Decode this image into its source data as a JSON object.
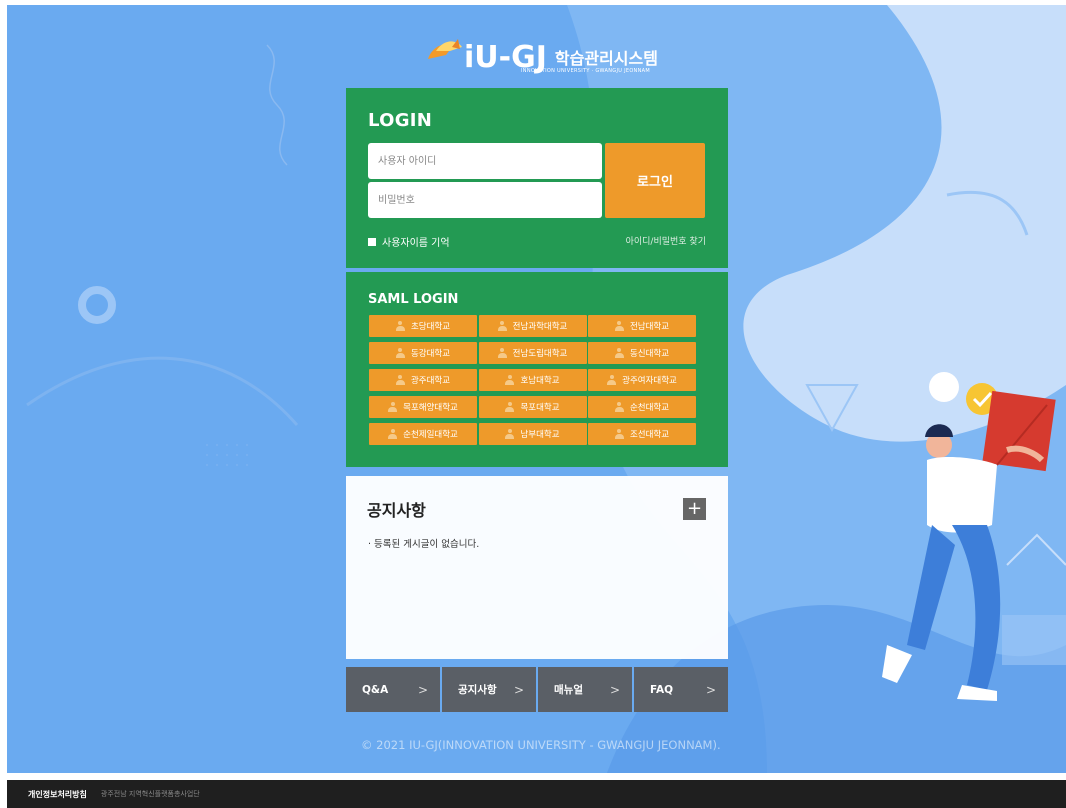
{
  "logo": {
    "brand": "iU-GJ",
    "subtitle": "학습관리시스템",
    "tagline": "INNOVATION UNIVERSITY · GWANGJU JEONNAM"
  },
  "login": {
    "title": "LOGIN",
    "username_placeholder": "사용자 아이디",
    "password_placeholder": "비밀번호",
    "login_button": "로그인",
    "remember_label": "사용자이름 기억",
    "find_link": "아이디/비밀번호 찾기"
  },
  "saml": {
    "title": "SAML LOGIN",
    "universities": [
      "초당대학교",
      "전남과학대학교",
      "전남대학교",
      "동강대학교",
      "전남도립대학교",
      "동신대학교",
      "광주대학교",
      "호남대학교",
      "광주여자대학교",
      "목포해양대학교",
      "목포대학교",
      "순천대학교",
      "순천제일대학교",
      "남부대학교",
      "조선대학교"
    ]
  },
  "notice": {
    "title": "공지사항",
    "plus": "+",
    "empty_message": "· 등록된 게시글이 없습니다."
  },
  "nav": {
    "tabs": [
      {
        "label": "Q&A",
        "chevron": ">"
      },
      {
        "label": "공지사항",
        "chevron": ">"
      },
      {
        "label": "매뉴얼",
        "chevron": ">"
      },
      {
        "label": "FAQ",
        "chevron": ">"
      }
    ]
  },
  "copyright": "© 2021 IU-GJ(INNOVATION UNIVERSITY - GWANGJU JEONNAM).",
  "footer": {
    "privacy": "개인정보처리방침",
    "org": "광주전남 지역혁신플랫폼총사업단"
  },
  "colors": {
    "background": "#6aaaf0",
    "panel_green": "#239a53",
    "accent_orange": "#ee9a2a",
    "nav_gray": "#5a5f66",
    "footer_dark": "#1f1f1f"
  }
}
